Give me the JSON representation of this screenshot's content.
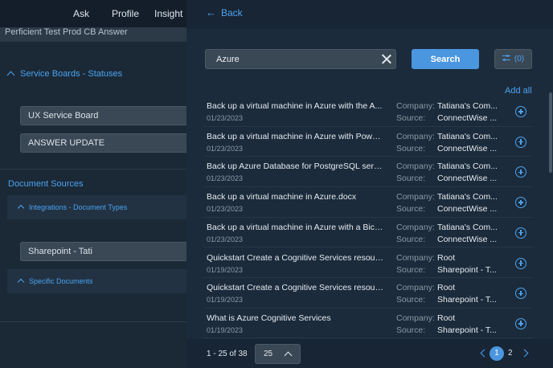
{
  "left": {
    "nav": [
      "Ask",
      "Profile",
      "Insight"
    ],
    "top_answer": "Perficient Test Prod CB Answer",
    "service_boards_title": "Service Boards - Statuses",
    "boards": [
      "UX Service Board",
      "ANSWER UPDATE"
    ],
    "document_sources_title": "Document Sources",
    "integrations_title": "Integrations - Document Types",
    "sharepoint_field": "Sharepoint - Tati",
    "specific_documents_title": "Specific Documents"
  },
  "drawer": {
    "back_label": "Back",
    "search": {
      "value": "Azure",
      "placeholder": ""
    },
    "search_button": "Search",
    "filter_count": "(0)",
    "add_all": "Add all",
    "labels": {
      "company": "Company:",
      "source": "Source:"
    },
    "results": [
      {
        "title": "Back up a virtual machine in Azure with the A...",
        "date": "01/23/2023",
        "company": "Tatiana's Com...",
        "source": "ConnectWise ..."
      },
      {
        "title": "Back up a virtual machine in Azure with Power...",
        "date": "01/23/2023",
        "company": "Tatiana's Com...",
        "source": "ConnectWise ..."
      },
      {
        "title": "Back up Azure Database for PostgreSQL serve...",
        "date": "01/23/2023",
        "company": "Tatiana's Com...",
        "source": "ConnectWise ..."
      },
      {
        "title": "Back up a virtual machine in Azure.docx",
        "date": "01/23/2023",
        "company": "Tatiana's Com...",
        "source": "ConnectWise ..."
      },
      {
        "title": "Back up a virtual machine in Azure with a Bice...",
        "date": "01/23/2023",
        "company": "Tatiana's Com...",
        "source": "ConnectWise ..."
      },
      {
        "title": "Quickstart Create a Cognitive Services resourc...",
        "date": "01/19/2023",
        "company": "Root",
        "source": "Sharepoint - T..."
      },
      {
        "title": "Quickstart Create a Cognitive Services resourc...",
        "date": "01/19/2023",
        "company": "Root",
        "source": "Sharepoint - T..."
      },
      {
        "title": "What is Azure Cognitive Services",
        "date": "01/19/2023",
        "company": "Root",
        "source": "Sharepoint - T..."
      }
    ],
    "footer": {
      "range": "1 - 25 of 38",
      "page_size": "25",
      "pages": [
        "1",
        "2"
      ],
      "current_page": "1"
    }
  },
  "colors": {
    "accent": "#4a96df",
    "link": "#4aa3f0",
    "panel": "#1c2b3b"
  }
}
